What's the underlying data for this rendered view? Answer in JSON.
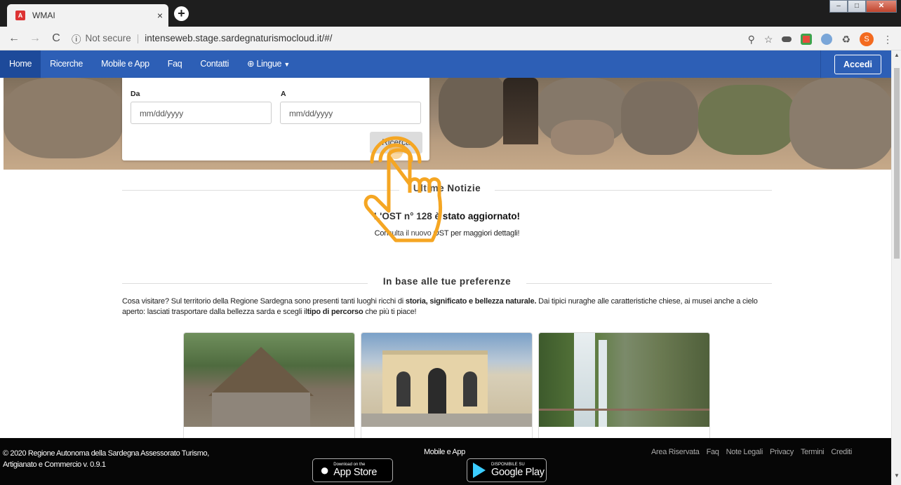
{
  "browser": {
    "tab_title": "WMAI",
    "tab_favicon": "A",
    "close_tab": "×",
    "new_tab": "+",
    "not_secure": "Not secure",
    "url": "intenseweb.stage.sardegnaturismocloud.it/#/",
    "profile_initial": "S"
  },
  "nav": {
    "items": [
      "Home",
      "Ricerche",
      "Mobile e App",
      "Faq",
      "Contatti"
    ],
    "language_label": "Lingue",
    "login_label": "Accedi"
  },
  "search": {
    "from_label": "Da",
    "to_label": "A",
    "from_placeholder": "mm/dd/yyyy",
    "to_placeholder": "mm/dd/yyyy",
    "button_label": "Ricerca"
  },
  "news": {
    "section_title": "Ultime Notizie",
    "headline": "L'OST n° 128 è stato aggiornato!",
    "text": "Consulta il nuovo OST per maggiori dettagli!"
  },
  "preferences": {
    "section_title": "In base alle tue preferenze",
    "intro_before": "Cosa visitare? Sul territorio della Regione Sardegna sono presenti tanti luoghi ricchi di ",
    "intro_bold1": "storia, significato e bellezza naturale.",
    "intro_mid": " Dai tipici nuraghe alle caratteristiche chiese, ai musei anche a cielo aperto: lasciati trasportare dalla bellezza sarda e scegli il",
    "intro_bold2": "tipo di percorso",
    "intro_after": " che più ti piace!"
  },
  "footer": {
    "copyright_line1": "© 2020 Regione Autonoma della Sardegna Assessorato Turismo,",
    "copyright_line2": "Artigianato e Commercio v. 0.9.1",
    "mobile_title": "Mobile e App",
    "appstore_small": "Download on the",
    "appstore_big": "App Store",
    "googleplay_small": "DISPONIBILE SU",
    "googleplay_big": "Google Play",
    "links": [
      "Area Riservata",
      "Faq",
      "Note Legali",
      "Privacy",
      "Termini",
      "Crediti"
    ]
  },
  "colors": {
    "navbar": "#2d5fb6",
    "footer": "#060606",
    "hand_overlay": "#f5a623"
  }
}
